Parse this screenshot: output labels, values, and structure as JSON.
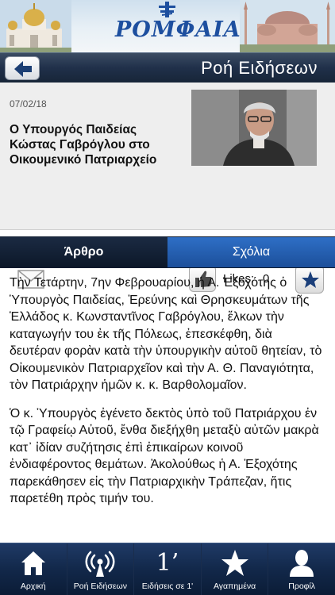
{
  "banner": {
    "logo_text": "ΡΟΜΦΑΙΑ",
    "icons": [
      "cathedral-left-image",
      "orthodox-cross-icon",
      "hagia-sophia-image"
    ]
  },
  "titlebar": {
    "title": "Ροή Ειδήσεων",
    "back_icon": "arrow-left-icon"
  },
  "article_header": {
    "date": "07/02/18",
    "headline": "Ο Υπουργός Παιδείας Κώστας Γαβρόγλου στο Οικουμενικό Πατριαρχείο",
    "likes_label": "Likes:",
    "likes_count": "0",
    "icons": [
      "envelope-icon",
      "thumbs-up-icon",
      "star-icon"
    ]
  },
  "tabs": {
    "article": "Άρθρο",
    "comments": "Σχόλια",
    "active": "article"
  },
  "article": {
    "paragraphs": [
      "Τὴν Τετάρτην, 7ην Φεβρουαρίου, ἡ Α. Ἐξοχότης ὁ Ὑπουργὸς Παιδείας, Ἐρεύνης καὶ Θρησκευμάτων τῆς Ἑλλάδος κ. Κωνσταντῖνος Γαβρόγλου, ἕλκων τὴν καταγωγήν του ἐκ τῆς Πόλεως, ἐπεσκέφθη, διὰ δευτέραν φορὰν κατὰ τὴν ὑπουργικὴν αὐτοῦ θητείαν, τὸ Οἰκουμενικὸν Πατριαρχεῖον καὶ τὴν Α. Θ. Παναγιότητα, τὸν Πατριάρχην ἡμῶν κ. κ. Βαρθολομαῖον.",
      "Ὁ κ. Ὑπουργὸς ἐγένετο δεκτὸς ὑπὸ τοῦ Πατριάρχου ἐν τῷ Γραφείῳ Αὐτοῦ, ἔνθα διεξήχθη μεταξὺ αὐτῶν μακρὰ κατ᾿ ἰδίαν συζήτησις ἐπὶ ἐπικαίρων κοινοῦ ἐνδιαφέροντος θεμάτων. Ἀκολούθως ἡ Α. Ἐξοχότης παρεκάθησεν εἰς τὴν Πατριαρχικὴν Τράπεζαν, ἥτις παρετέθη πρὸς τιμήν του."
    ]
  },
  "tabbar": {
    "items": [
      {
        "label": "Αρχική",
        "icon": "home-icon"
      },
      {
        "label": "Ροή Ειδήσεων",
        "icon": "broadcast-antenna-icon"
      },
      {
        "label": "Ειδήσεις σε 1'",
        "icon": "one-minute-icon",
        "glyph": "1’"
      },
      {
        "label": "Αγαπημένα",
        "icon": "star-icon"
      },
      {
        "label": "Προφίλ",
        "icon": "user-icon"
      }
    ]
  },
  "colors": {
    "title_bar": "#20304a",
    "tab_active": "#0c1829",
    "tab_inactive": "#2e6fc6",
    "tabbar": "#12284a",
    "logo_blue": "#1d4f9f"
  }
}
